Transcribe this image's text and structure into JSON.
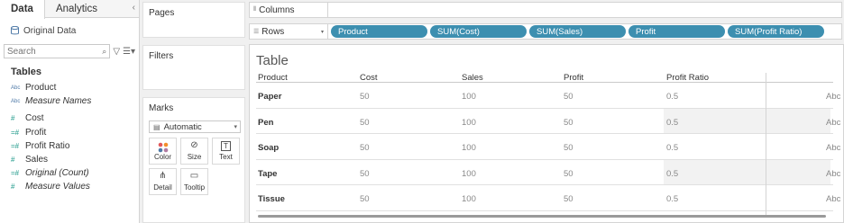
{
  "data_pane": {
    "tabs": [
      "Data",
      "Analytics"
    ],
    "collapse_icon": "chevron-left-icon",
    "source": "Original Data",
    "search_placeholder": "Search",
    "tables_title": "Tables",
    "dimensions": [
      {
        "label": "Product",
        "icon": "Abc",
        "italic": false
      },
      {
        "label": "Measure Names",
        "icon": "Abc",
        "italic": true
      }
    ],
    "measures": [
      {
        "label": "Cost",
        "icon": "#",
        "italic": false
      },
      {
        "label": "Profit",
        "icon": "=#",
        "italic": false
      },
      {
        "label": "Profit Ratio",
        "icon": "=#",
        "italic": false
      },
      {
        "label": "Sales",
        "icon": "#",
        "italic": false
      },
      {
        "label": "Original (Count)",
        "icon": "=#",
        "italic": true
      },
      {
        "label": "Measure Values",
        "icon": "#",
        "italic": true
      }
    ]
  },
  "cards": {
    "pages": "Pages",
    "filters": "Filters",
    "marks": "Marks",
    "mark_type": "Automatic",
    "buttons": [
      "Color",
      "Size",
      "Text",
      "Detail",
      "Tooltip"
    ]
  },
  "shelves": {
    "columns_label": "Columns",
    "rows_label": "Rows",
    "row_pills": [
      "Product",
      "SUM(Cost)",
      "SUM(Sales)",
      "Profit",
      "SUM(Profit Ratio)"
    ]
  },
  "view": {
    "title": "Table",
    "headers": [
      "Product",
      "Cost",
      "Sales",
      "Profit",
      "Profit Ratio"
    ],
    "rows": [
      {
        "product": "Paper",
        "cost": "50",
        "sales": "100",
        "profit": "50",
        "ratio": "0.5",
        "cut": "Abc"
      },
      {
        "product": "Pen",
        "cost": "50",
        "sales": "100",
        "profit": "50",
        "ratio": "0.5",
        "cut": "Abc"
      },
      {
        "product": "Soap",
        "cost": "50",
        "sales": "100",
        "profit": "50",
        "ratio": "0.5",
        "cut": "Abc"
      },
      {
        "product": "Tape",
        "cost": "50",
        "sales": "100",
        "profit": "50",
        "ratio": "0.5",
        "cut": "Abc"
      },
      {
        "product": "Tissue",
        "cost": "50",
        "sales": "100",
        "profit": "50",
        "ratio": "0.5",
        "cut": "Abc"
      }
    ]
  },
  "colors": {
    "pill": "#3d8fb0",
    "measure_icon": "#1f9a8a",
    "dimension_icon": "#4e79a7"
  }
}
